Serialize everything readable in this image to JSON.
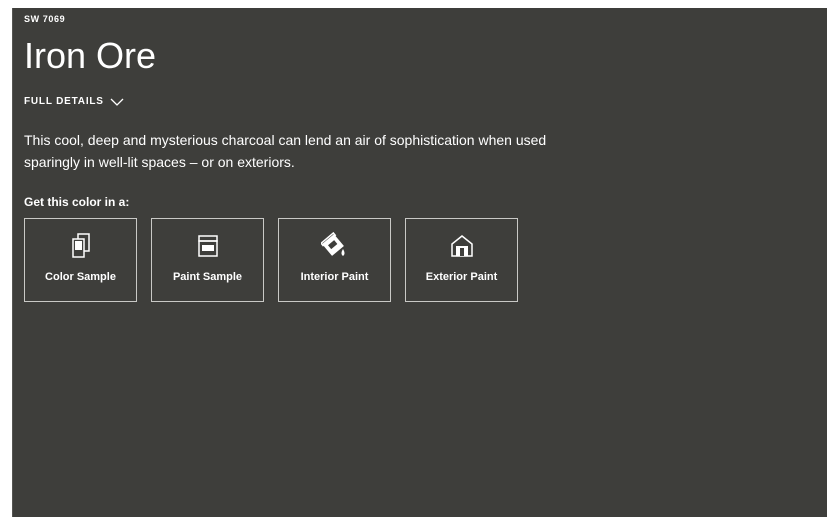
{
  "color": {
    "code": "SW 7069",
    "name": "Iron Ore",
    "details_label": "FULL DETAILS",
    "description": "This cool, deep and mysterious charcoal can lend an air of sophistication when used sparingly in well-lit spaces – or on exteriors."
  },
  "get_label": "Get this color in a:",
  "options": [
    {
      "label": "Color Sample",
      "icon": "color-sample-icon"
    },
    {
      "label": "Paint Sample",
      "icon": "paint-sample-icon"
    },
    {
      "label": "Interior Paint",
      "icon": "paint-can-icon"
    },
    {
      "label": "Exterior Paint",
      "icon": "house-icon"
    }
  ],
  "colors": {
    "panel_background": "#3e3e3b",
    "text": "#ffffff",
    "border": "#c9c9c6"
  }
}
